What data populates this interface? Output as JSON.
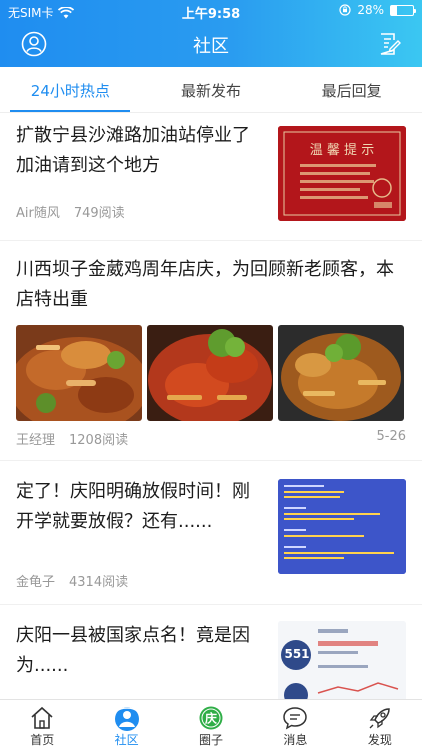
{
  "status_bar": {
    "carrier": "无SIM卡",
    "time": "上午9:58",
    "battery": "28%",
    "battery_level": 0.28
  },
  "nav": {
    "title": "社区",
    "left_icon": "user-icon",
    "right_icon": "edit-icon"
  },
  "tabs": [
    {
      "label": "24小时热点",
      "active": true
    },
    {
      "label": "最新发布",
      "active": false
    },
    {
      "label": "最后回复",
      "active": false
    }
  ],
  "articles": [
    {
      "title": "扩散宁县沙滩路加油站停业了加油请到这个地方",
      "author": "Air随风",
      "reads": "749阅读",
      "thumb_text": "温 馨 提 示"
    },
    {
      "title": "川西坝子金葳鸡周年店庆，为回顾新老顾客，本店特出重",
      "author": "王经理",
      "reads": "1208阅读",
      "date": "5-26"
    },
    {
      "title": "定了！庆阳明确放假时间！刚开学就要放假？还有......",
      "author": "金龟子",
      "reads": "4314阅读"
    },
    {
      "title": "庆阳一县被国家点名！竟是因为......",
      "thumb_number": "551"
    }
  ],
  "tabbar": [
    {
      "label": "首页",
      "icon": "home-icon",
      "active": false
    },
    {
      "label": "社区",
      "icon": "community-icon",
      "active": true
    },
    {
      "label": "圈子",
      "icon": "circle-icon",
      "active": false
    },
    {
      "label": "消息",
      "icon": "message-icon",
      "active": false
    },
    {
      "label": "发现",
      "icon": "rocket-icon",
      "active": false
    }
  ],
  "colors": {
    "accent": "#1f8df0",
    "header_start": "#1f8df0",
    "header_end": "#3bc7f2",
    "circle_green": "#2fae47"
  }
}
